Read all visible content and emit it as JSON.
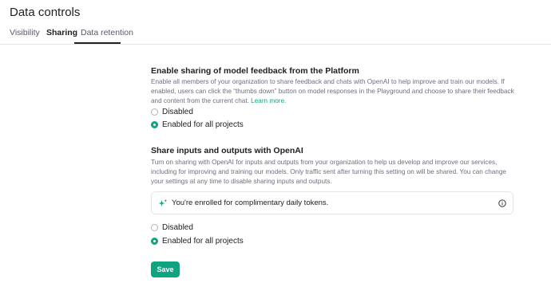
{
  "page_title": "Data controls",
  "tabs": [
    {
      "label": "Visibility",
      "active": false
    },
    {
      "label": "Sharing",
      "active": true
    },
    {
      "label": "Data retention",
      "active": false
    }
  ],
  "feedback_section": {
    "title": "Enable sharing of model feedback from the Platform",
    "description": "Enable all members of your organization to share feedback and chats with OpenAI to help improve and train our models. If enabled, users can click the “thumbs down” button on model responses in the Playground and choose to share their feedback and content from the current chat.",
    "link_text": "Learn more.",
    "options": [
      {
        "label": "Disabled",
        "checked": false
      },
      {
        "label": "Enabled for all projects",
        "checked": true
      }
    ]
  },
  "io_section": {
    "title": "Share inputs and outputs with OpenAI",
    "description": "Turn on sharing with OpenAI for inputs and outputs from your organization to help us develop and improve our services, including for improving and training our models. Only traffic sent after turning this setting on will be shared. You can change your settings at any time to disable sharing inputs and outputs.",
    "notice_text": "You're enrolled for complimentary daily tokens.",
    "options": [
      {
        "label": "Disabled",
        "checked": false
      },
      {
        "label": "Enabled for all projects",
        "checked": true
      }
    ]
  },
  "save_label": "Save",
  "colors": {
    "accent": "#10a37f",
    "text": "#202123",
    "muted": "#6e6e80",
    "border": "#e5e5e5"
  },
  "icons": {
    "notice": "sparkle-icon",
    "info": "info-circle-icon"
  }
}
